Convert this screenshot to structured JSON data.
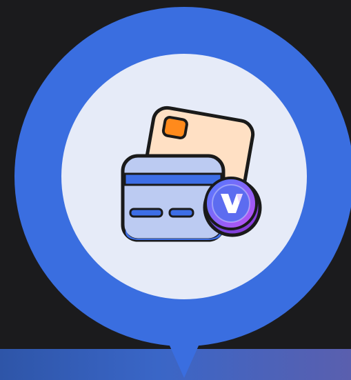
{
  "graphic": {
    "name": "card-payment-badge",
    "colors": {
      "background": "#1b1b1d",
      "pin_ring": "#3a6ee0",
      "inner_disc": "#e6ebf8",
      "back_card": "#ffe0c4",
      "back_card_chip": "#ff8a1c",
      "front_card": "#bccbf2",
      "front_card_stripe": "#3d6ee6",
      "outline": "#1a1a1a",
      "coin_gradient_start": "#4a7cff",
      "coin_gradient_end": "#c34df0"
    },
    "icons": [
      "location-pin-icon",
      "credit-card-icon",
      "coin-icon",
      "letter-v-logo-icon"
    ]
  }
}
